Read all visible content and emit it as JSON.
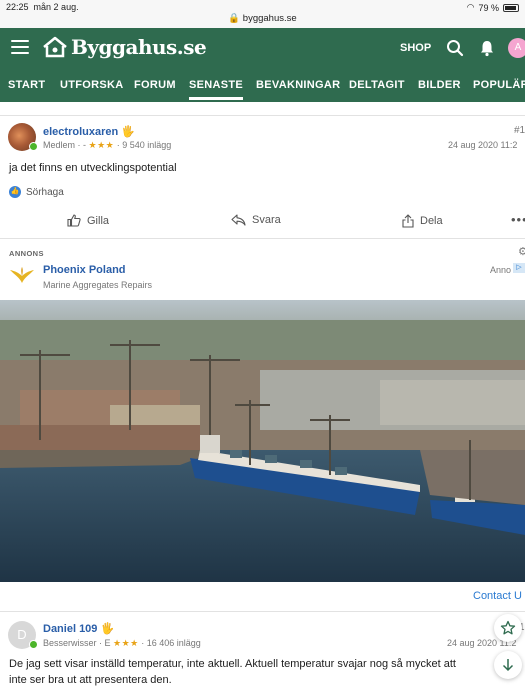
{
  "status": {
    "time": "22:25",
    "date": "mån 2 aug.",
    "battery": "79 %"
  },
  "browser": {
    "url": "byggahus.se"
  },
  "header": {
    "logo": "Byggahus.se",
    "shop": "SHOP",
    "avatar_letter": "A"
  },
  "nav": [
    "START",
    "UTFORSKA",
    "FORUM",
    "SENASTE",
    "BEVAKNINGAR",
    "DELTAGIT",
    "BILDER",
    "POPULÄR"
  ],
  "nav_active": "SENASTE",
  "post1": {
    "username": "electroluxaren",
    "badge": "🖐",
    "role": "Medlem · -",
    "stars": "★★★",
    "posts": "· 9 540 inlägg",
    "number": "#1",
    "date": "24 aug 2020 11:2",
    "body": "ja det finns en utvecklingspotential",
    "reaction_user": "Sörhaga",
    "actions": {
      "like": "Gilla",
      "reply": "Svara",
      "share": "Dela"
    }
  },
  "ad": {
    "label": "ANNONS",
    "title": "Phoenix Poland",
    "subtitle": "Marine Aggregates Repairs",
    "tag": "Anno",
    "contact": "Contact U"
  },
  "post2": {
    "username": "Daniel 109",
    "badge": "🖐",
    "avatar_letter": "D",
    "role": "Besserwisser · E",
    "stars": "★★★",
    "posts": "· 16 406 inlägg",
    "number": "1",
    "date": "24 aug 2020 11:2",
    "body_line1": "De jag sett visar inställd temperatur, inte aktuell. Aktuell temperatur svajar nog så mycket att",
    "body_line2": "inte ser bra ut att presentera den."
  },
  "colors": {
    "brand_green": "#2f6b4f",
    "link_blue": "#2a5ea8",
    "star": "#e8a317"
  }
}
